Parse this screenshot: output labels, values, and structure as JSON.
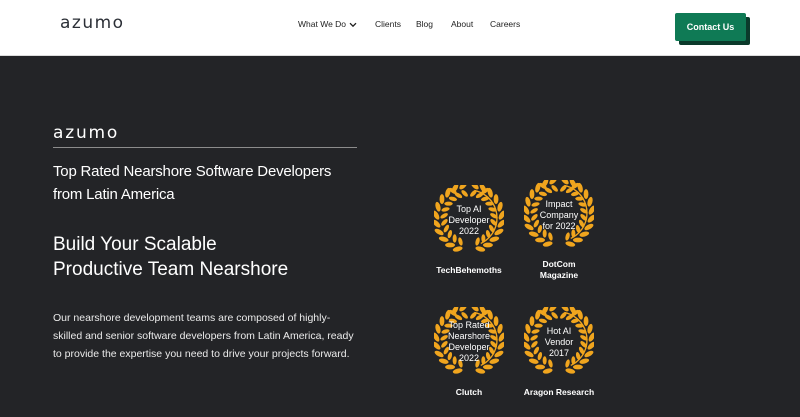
{
  "header": {
    "logo": "azumo",
    "nav": [
      {
        "label": "What We Do",
        "has_dropdown": true
      },
      {
        "label": "Clients"
      },
      {
        "label": "Blog"
      },
      {
        "label": "About"
      },
      {
        "label": "Careers"
      }
    ],
    "contact_label": "Contact Us"
  },
  "hero": {
    "logo": "azumo",
    "tagline": "Top Rated Nearshore Software Developers from Latin America",
    "headline_line1": "Build Your Scalable",
    "headline_line2": "Productive Team Nearshore",
    "body": "Our nearshore development teams are composed of highly-skilled and senior software developers from Latin America, ready to provide the expertise you need to drive your projects forward."
  },
  "badges": [
    {
      "lines": [
        "Top AI",
        "Developer",
        "2022"
      ],
      "source_lines": [
        "TechBehemoths"
      ]
    },
    {
      "lines": [
        "Impact",
        "Company",
        "for 2022"
      ],
      "source_lines": [
        "DotCom",
        "Magazine"
      ]
    },
    {
      "lines": [
        "Top Rated",
        "Nearshore",
        "Developer",
        "2022"
      ],
      "source_lines": [
        "Clutch"
      ]
    },
    {
      "lines": [
        "Hot AI",
        "Vendor",
        "2017"
      ],
      "source_lines": [
        "Aragon Research"
      ]
    }
  ],
  "colors": {
    "brand_green": "#0f7a55",
    "hero_background": "#232427",
    "laurel_gold": "#f0a51e"
  },
  "icons": {
    "dropdown": "chevron-down-icon",
    "badge_frame": "laurel-wreath-icon"
  }
}
